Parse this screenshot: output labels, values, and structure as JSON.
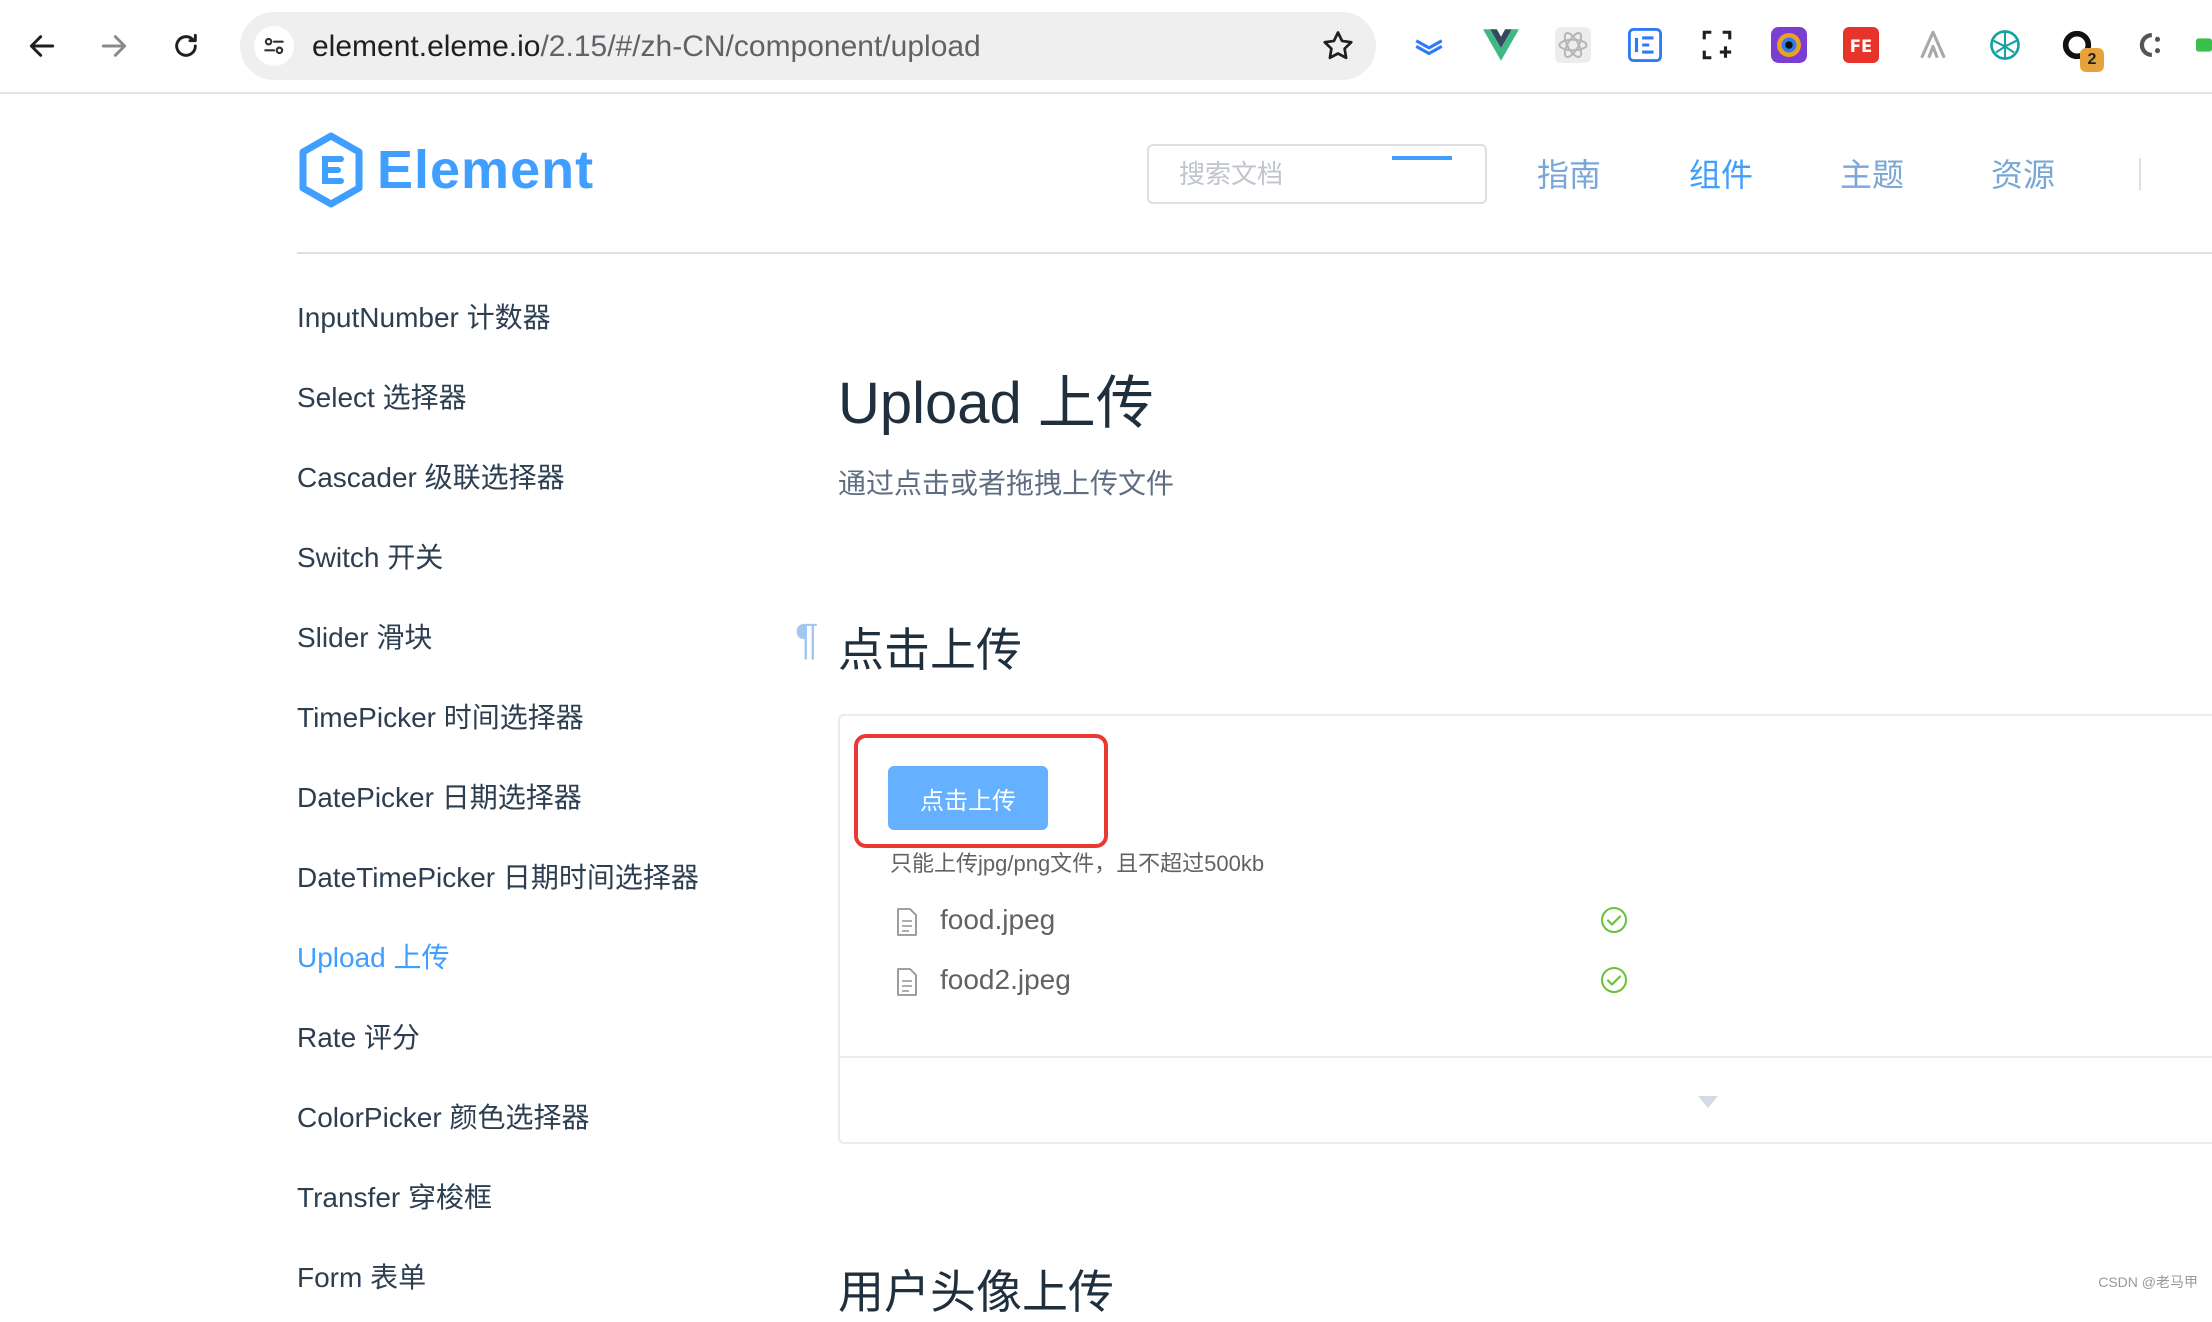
{
  "browser": {
    "url_host": "element.eleme.io",
    "url_path": "/2.15/#/zh-CN/component/upload",
    "extension_badge": "2"
  },
  "header": {
    "logo_text": "Element",
    "search_placeholder": "搜索文档",
    "nav": [
      "指南",
      "组件",
      "主题",
      "资源"
    ],
    "active_nav": "组件",
    "accent_color": "#409eff"
  },
  "sidebar": {
    "items": [
      "InputNumber 计数器",
      "Select 选择器",
      "Cascader 级联选择器",
      "Switch 开关",
      "Slider 滑块",
      "TimePicker 时间选择器",
      "DatePicker 日期选择器",
      "DateTimePicker 日期时间选择器",
      "Upload 上传",
      "Rate 评分",
      "ColorPicker 颜色选择器",
      "Transfer 穿梭框",
      "Form 表单"
    ],
    "active_item": "Upload 上传"
  },
  "main": {
    "title": "Upload 上传",
    "description": "通过点击或者拖拽上传文件",
    "section_title": "点击上传",
    "anchor": "¶",
    "upload_button": "点击上传",
    "upload_tip": "只能上传jpg/png文件，且不超过500kb",
    "files": [
      {
        "name": "food.jpeg",
        "status": "success"
      },
      {
        "name": "food2.jpeg",
        "status": "success"
      }
    ],
    "next_section_title": "用户头像上传"
  },
  "watermark": "CSDN @老马甲"
}
